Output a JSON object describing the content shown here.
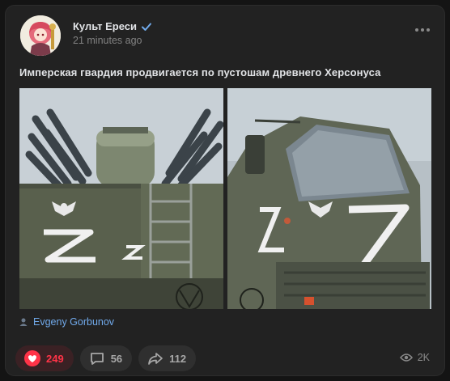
{
  "post": {
    "author": "Культ Ереси",
    "time": "21 minutes ago",
    "text": "Имперская гвардия продвигается по пустошам древнего Херсонуса",
    "verified": true,
    "signature": "Evgeny Gorbunov"
  },
  "images": [
    {
      "alt": "armored vehicle left",
      "painted_letter": "Z"
    },
    {
      "alt": "truck cab right",
      "painted_letter": "Z"
    }
  ],
  "actions": {
    "likes": "249",
    "comments": "56",
    "shares": "112",
    "views": "2K"
  },
  "colors": {
    "like_accent": "#ff3347",
    "link": "#71aaeb",
    "verified": "#71aaeb"
  },
  "icons": {
    "more": "more-dots-icon",
    "verified": "verified-check-icon",
    "like": "heart-icon",
    "comment": "comment-bubble-icon",
    "share": "share-arrow-icon",
    "views": "eye-icon",
    "signature": "person-icon"
  }
}
